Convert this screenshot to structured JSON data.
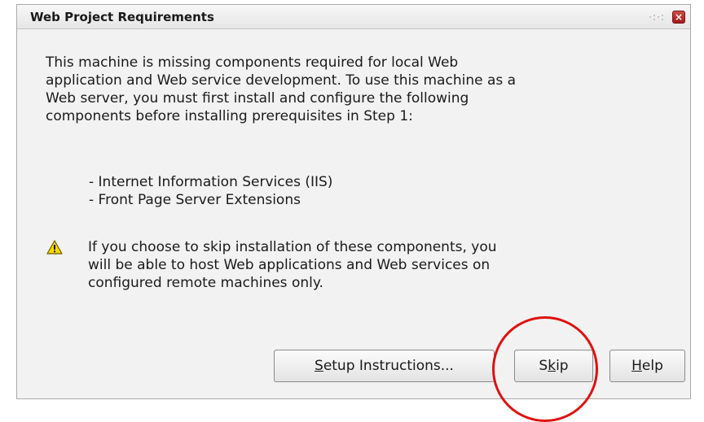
{
  "dialog": {
    "title": "Web Project Requirements",
    "close_icon_glyph": "×",
    "message": "This machine is missing components required for local Web\napplication and Web service development. To use this machine as a\nWeb server, you must first install and configure the following\ncomponents before installing prerequisites in Step 1:",
    "components": [
      "- Internet Information Services (IIS)",
      "- Front Page Server Extensions"
    ],
    "warning_icon": "warning-triangle-icon",
    "warning_text": "If you choose to skip installation of these components, you\nwill be able to host Web applications and Web services on\nconfigured remote machines only."
  },
  "buttons": {
    "setup": {
      "mnemonic": "S",
      "rest": "etup Instructions..."
    },
    "skip": {
      "before": "S",
      "mnemonic": "k",
      "after": "ip"
    },
    "help": {
      "mnemonic": "H",
      "rest": "elp"
    }
  },
  "annotation": {
    "highlight_color": "#e01010",
    "highlight_target": "skip-button"
  },
  "colors": {
    "close_button": "#c03030",
    "dialog_background": "#f2f2f2"
  }
}
